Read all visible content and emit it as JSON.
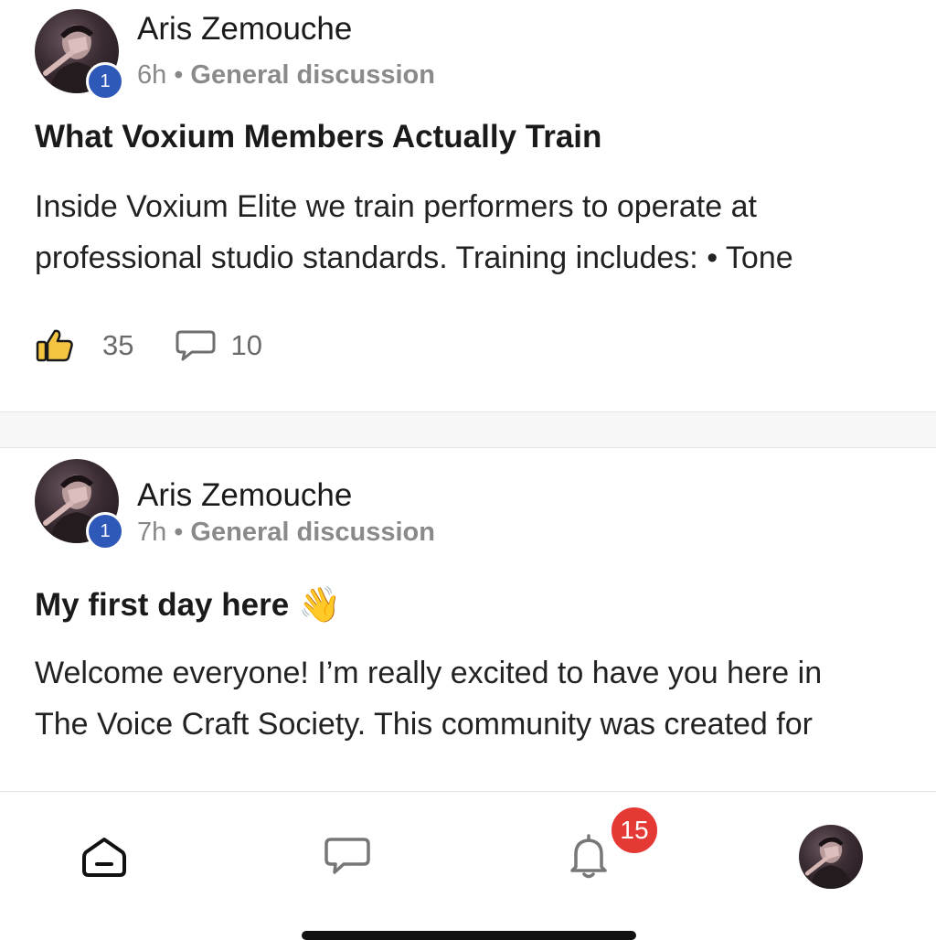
{
  "posts": [
    {
      "author": "Aris Zemouche",
      "level": "1",
      "time": "6h",
      "separator": "•",
      "category": "General discussion",
      "title": "What Voxium Members Actually Train",
      "body_line1": "Inside Voxium Elite we train performers to operate at",
      "body_line2": "professional studio standards. Training includes: • Tone",
      "likes": "35",
      "comments": "10",
      "like_icon": "thumbs-up-icon",
      "comment_icon": "comment-icon"
    },
    {
      "author": "Aris Zemouche",
      "level": "1",
      "time": "7h",
      "separator": "•",
      "category": "General discussion",
      "title": "My first day here",
      "title_emoji": "👋",
      "body_line1": "Welcome everyone! I’m really excited to have you here in",
      "body_line2": "The Voice Craft Society. This community was created for"
    }
  ],
  "nav": {
    "home_icon": "home-icon",
    "chat_icon": "chat-icon",
    "bell_icon": "bell-icon",
    "notification_count": "15",
    "profile_icon": "profile-avatar"
  },
  "colors": {
    "level_badge": "#2f59b8",
    "notification_badge": "#e53935",
    "like_icon": "#f5c542"
  }
}
